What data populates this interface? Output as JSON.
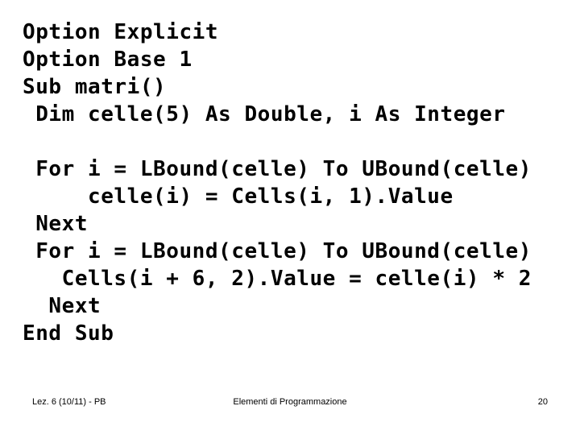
{
  "slide": {
    "background_color": "#ffffff",
    "text_color": "#000000"
  },
  "code": {
    "language": "VBA",
    "lines": [
      "Option Explicit",
      "Option Base 1",
      "Sub matri()",
      " Dim celle(5) As Double, i As Integer",
      "",
      " For i = LBound(celle) To UBound(celle)",
      "     celle(i) = Cells(i, 1).Value",
      " Next",
      " For i = LBound(celle) To UBound(celle)",
      "   Cells(i + 6, 2).Value = celle(i) * 2",
      "  Next",
      "End Sub"
    ]
  },
  "footer": {
    "left": "Lez. 6 (10/11) - PB",
    "center": "Elementi di Programmazione",
    "right": "20"
  }
}
